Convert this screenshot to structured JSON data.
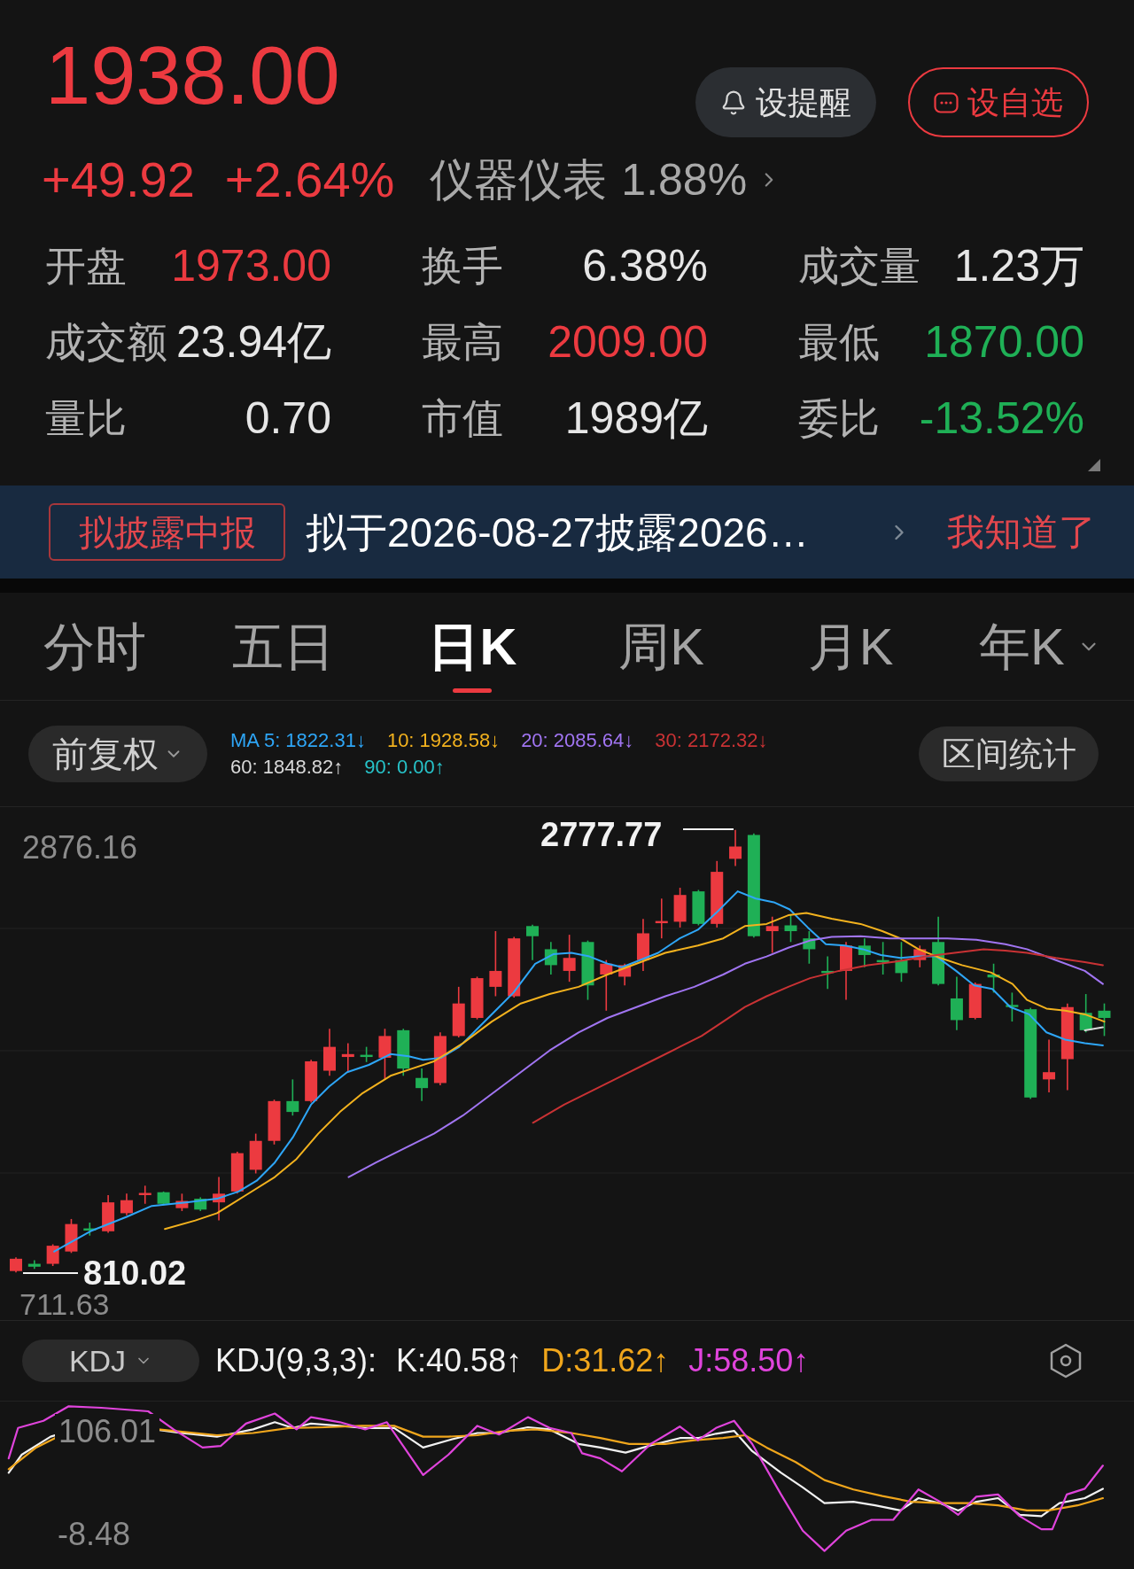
{
  "quote": {
    "price": "1938.00",
    "rising": true,
    "change": "+49.92",
    "change_percent": "+2.64%",
    "sector": "仪器仪表",
    "sector_change": "1.88%"
  },
  "actions": [
    {
      "kind": "alert",
      "label": "设提醒"
    },
    {
      "kind": "watchlist",
      "label": "设自选"
    }
  ],
  "stats": [
    {
      "label": "开盘",
      "value": "1973.00",
      "color": "#ec3a40"
    },
    {
      "label": "换手",
      "value": "6.38%",
      "color": "#e6e6e6"
    },
    {
      "label": "成交量",
      "value": "1.23万",
      "color": "#e6e6e6"
    },
    {
      "label": "成交额",
      "value": "23.94亿",
      "color": "#e6e6e6"
    },
    {
      "label": "最高",
      "value": "2009.00",
      "color": "#ec3a40"
    },
    {
      "label": "最低",
      "value": "1870.00",
      "color": "#1fb056"
    },
    {
      "label": "量比",
      "value": "0.70",
      "color": "#e6e6e6"
    },
    {
      "label": "市值",
      "value": "1989亿",
      "color": "#e6e6e6"
    },
    {
      "label": "委比",
      "value": "-13.52%",
      "color": "#1fb056"
    }
  ],
  "notice": {
    "tag": "拟披露中报",
    "text": "拟于2026-08-27披露2026…",
    "dismiss": "我知道了"
  },
  "period_tabs": [
    {
      "label": "分时",
      "selected": false,
      "has_menu": false
    },
    {
      "label": "五日",
      "selected": false,
      "has_menu": false
    },
    {
      "label": "日K",
      "selected": true,
      "has_menu": false
    },
    {
      "label": "周K",
      "selected": false,
      "has_menu": false
    },
    {
      "label": "月K",
      "selected": false,
      "has_menu": false
    },
    {
      "label": "年K",
      "selected": false,
      "has_menu": true
    }
  ],
  "chart": {
    "adjustment": "前复权",
    "ma_legend": [
      [
        {
          "text": "MA 5: 1822.31↓",
          "color": "#2ea6f7"
        },
        {
          "text": "10: 1928.58↓",
          "color": "#f3b21e"
        },
        {
          "text": "20: 2085.64↓",
          "color": "#a175f2"
        },
        {
          "text": "30: 2172.32↓",
          "color": "#c93234"
        }
      ],
      [
        {
          "text": "60: 1848.82↑",
          "color": "#d9d9d9"
        },
        {
          "text": "90: 0.00↑",
          "color": "#27c3c9"
        }
      ]
    ],
    "range_stats": "区间统计",
    "y_max_label": "2876.16",
    "y_min_label": "711.63",
    "high_label": "2777.77",
    "low_label": "810.02"
  },
  "indicator": {
    "selector": "KDJ",
    "params": "KDJ(9,3,3):",
    "values": [
      {
        "text": "K:40.58↑",
        "color": "#f2f2f2"
      },
      {
        "text": "D:31.62↑",
        "color": "#f0a61c"
      },
      {
        "text": "J:58.50↑",
        "color": "#e044dc"
      }
    ],
    "y_max_label": "106.01",
    "y_min_label": "-8.48"
  }
}
